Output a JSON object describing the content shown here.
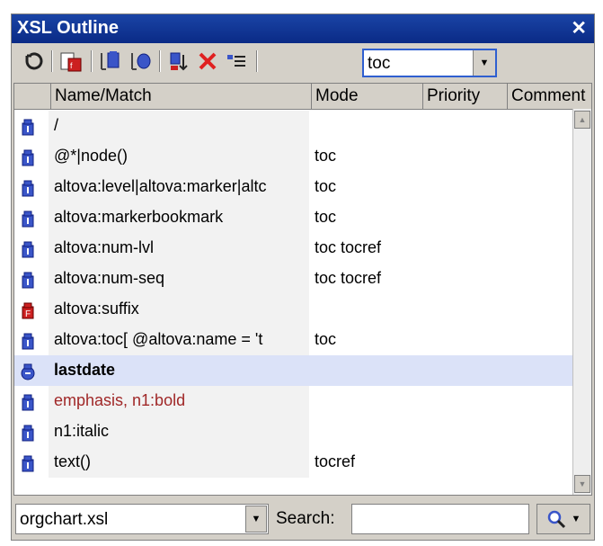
{
  "window": {
    "title": "XSL Outline",
    "close_icon": "close-icon"
  },
  "toolbar": {
    "buttons": [
      {
        "name": "sync-button",
        "icon": "sync-icon"
      },
      {
        "name": "template-calls-button",
        "icon": "template-calls-icon"
      },
      {
        "name": "named-template-button",
        "icon": "named-template-icon"
      },
      {
        "name": "match-template-button",
        "icon": "match-template-icon"
      },
      {
        "name": "sort-button",
        "icon": "sort-icon"
      },
      {
        "name": "delete-button",
        "icon": "delete-icon"
      },
      {
        "name": "list-button",
        "icon": "list-icon"
      }
    ],
    "mode_value": "toc"
  },
  "colors": {
    "accent": "#2f5fd0",
    "title_bg": "#0a2a86",
    "selected_row": "#dbe2f8",
    "delete_red": "#e02020",
    "icon_blue": "#3a55c8",
    "icon_red": "#cc2020"
  },
  "columns": [
    "Name/Match",
    "Mode",
    "Priority",
    "Comment"
  ],
  "rows": [
    {
      "name": "/",
      "mode": "",
      "icon": "match-template-icon"
    },
    {
      "name": "@*|node()",
      "mode": "toc",
      "icon": "match-template-icon"
    },
    {
      "name": "altova:level|altova:marker|altc",
      "mode": "toc",
      "icon": "match-template-icon"
    },
    {
      "name": "altova:markerbookmark",
      "mode": "toc",
      "icon": "match-template-icon"
    },
    {
      "name": "altova:num-lvl",
      "mode": "toc tocref",
      "icon": "match-template-icon"
    },
    {
      "name": "altova:num-seq",
      "mode": "toc tocref",
      "icon": "match-template-icon"
    },
    {
      "name": "altova:suffix",
      "mode": "",
      "icon": "function-template-icon"
    },
    {
      "name": "altova:toc[ @altova:name = 't",
      "mode": "toc",
      "icon": "match-template-icon"
    },
    {
      "name": "lastdate",
      "mode": "",
      "icon": "named-template-icon"
    },
    {
      "name": "emphasis, n1:bold",
      "mode": "",
      "icon": "match-template-icon"
    },
    {
      "name": "n1:italic",
      "mode": "",
      "icon": "match-template-icon"
    },
    {
      "name": "text()",
      "mode": "tocref",
      "icon": "match-template-icon"
    }
  ],
  "bottom": {
    "file_value": "orgchart.xsl",
    "search_label": "Search:",
    "search_value": ""
  }
}
